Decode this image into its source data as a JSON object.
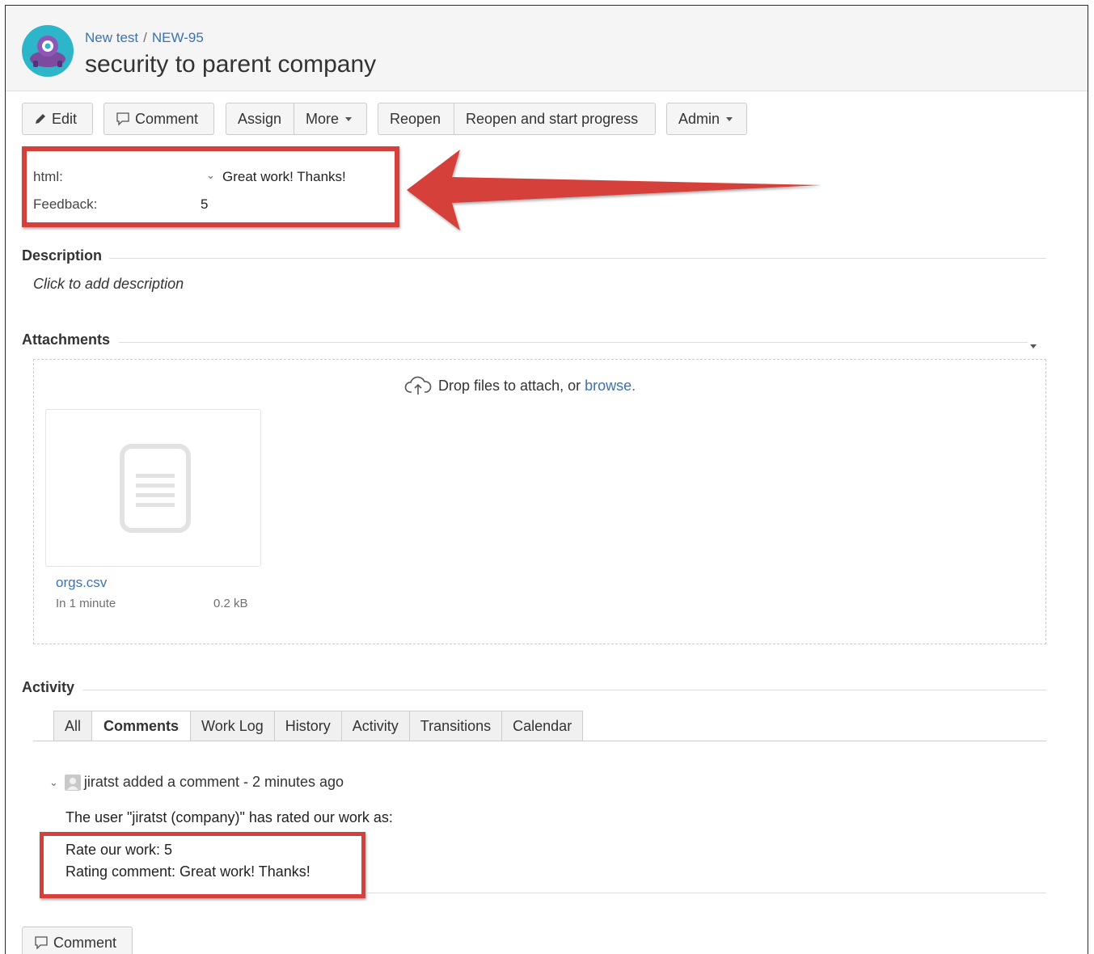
{
  "header": {
    "project": "New test",
    "separator": "/",
    "issue_key": "NEW-95",
    "title": "security to parent company"
  },
  "toolbar": {
    "edit": "Edit",
    "comment": "Comment",
    "assign": "Assign",
    "more": "More",
    "reopen": "Reopen",
    "reopen_start": "Reopen and start progress",
    "admin": "Admin"
  },
  "fields": {
    "html_label": "html:",
    "html_value": "Great work! Thanks!",
    "feedback_label": "Feedback:",
    "feedback_value": "5"
  },
  "description": {
    "heading": "Description",
    "placeholder": "Click to add description"
  },
  "attachments": {
    "heading": "Attachments",
    "drop_text": "Drop files to attach, or",
    "browse_link": "browse.",
    "files": [
      {
        "name": "orgs.csv",
        "date": "In 1 minute",
        "size": "0.2 kB"
      }
    ]
  },
  "activity": {
    "heading": "Activity",
    "tabs": [
      "All",
      "Comments",
      "Work Log",
      "History",
      "Activity",
      "Transitions",
      "Calendar"
    ],
    "active_tab": "Comments",
    "comment": {
      "author_line": "jiratst added a comment - 2 minutes ago",
      "line1": "The user \"jiratst (company)\" has rated our work as:",
      "line2": "Rate our work: 5",
      "line3": "Rating comment: Great work! Thanks!"
    },
    "comment_button": "Comment"
  },
  "colors": {
    "link": "#3b73af",
    "highlight": "#d5413a",
    "header_bg": "#f5f5f5"
  }
}
